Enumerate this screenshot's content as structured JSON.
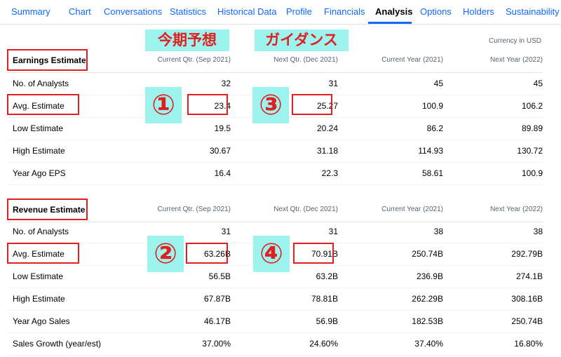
{
  "tabs": {
    "items": [
      {
        "label": "Summary"
      },
      {
        "label": "Chart"
      },
      {
        "label": "Conversations"
      },
      {
        "label": "Statistics"
      },
      {
        "label": "Historical Data"
      },
      {
        "label": "Profile"
      },
      {
        "label": "Financials"
      },
      {
        "label": "Analysis",
        "active": true
      },
      {
        "label": "Options"
      },
      {
        "label": "Holders"
      },
      {
        "label": "Sustainability"
      }
    ]
  },
  "currency_note": "Currency in USD",
  "annotations": {
    "current_forecast": "今期予想",
    "guidance": "ガイダンス",
    "markers": [
      "①",
      "②",
      "③",
      "④"
    ],
    "box_color": "#e02020",
    "highlight_color": "#9df3ee"
  },
  "earnings": {
    "headers": [
      "Earnings Estimate",
      "Current Qtr. (Sep 2021)",
      "Next Qtr. (Dec 2021)",
      "Current Year (2021)",
      "Next Year (2022)"
    ],
    "rows": [
      [
        "No. of Analysts",
        "32",
        "31",
        "45",
        "45"
      ],
      [
        "Avg. Estimate",
        "23.4",
        "25.27",
        "100.9",
        "106.2"
      ],
      [
        "Low Estimate",
        "19.5",
        "20.24",
        "86.2",
        "89.89"
      ],
      [
        "High Estimate",
        "30.67",
        "31.18",
        "114.93",
        "130.72"
      ],
      [
        "Year Ago EPS",
        "16.4",
        "22.3",
        "58.61",
        "100.9"
      ]
    ]
  },
  "revenue": {
    "headers": [
      "Revenue Estimate",
      "Current Qtr. (Sep 2021)",
      "Next Qtr. (Dec 2021)",
      "Current Year (2021)",
      "Next Year (2022)"
    ],
    "rows": [
      [
        "No. of Analysts",
        "31",
        "31",
        "38",
        "38"
      ],
      [
        "Avg. Estimate",
        "63.26B",
        "70.91B",
        "250.74B",
        "292.79B"
      ],
      [
        "Low Estimate",
        "56.5B",
        "63.2B",
        "236.9B",
        "274.1B"
      ],
      [
        "High Estimate",
        "67.87B",
        "78.81B",
        "262.29B",
        "308.16B"
      ],
      [
        "Year Ago Sales",
        "46.17B",
        "56.9B",
        "182.53B",
        "250.74B"
      ],
      [
        "Sales Growth (year/est)",
        "37.00%",
        "24.60%",
        "37.40%",
        "16.80%"
      ]
    ]
  }
}
